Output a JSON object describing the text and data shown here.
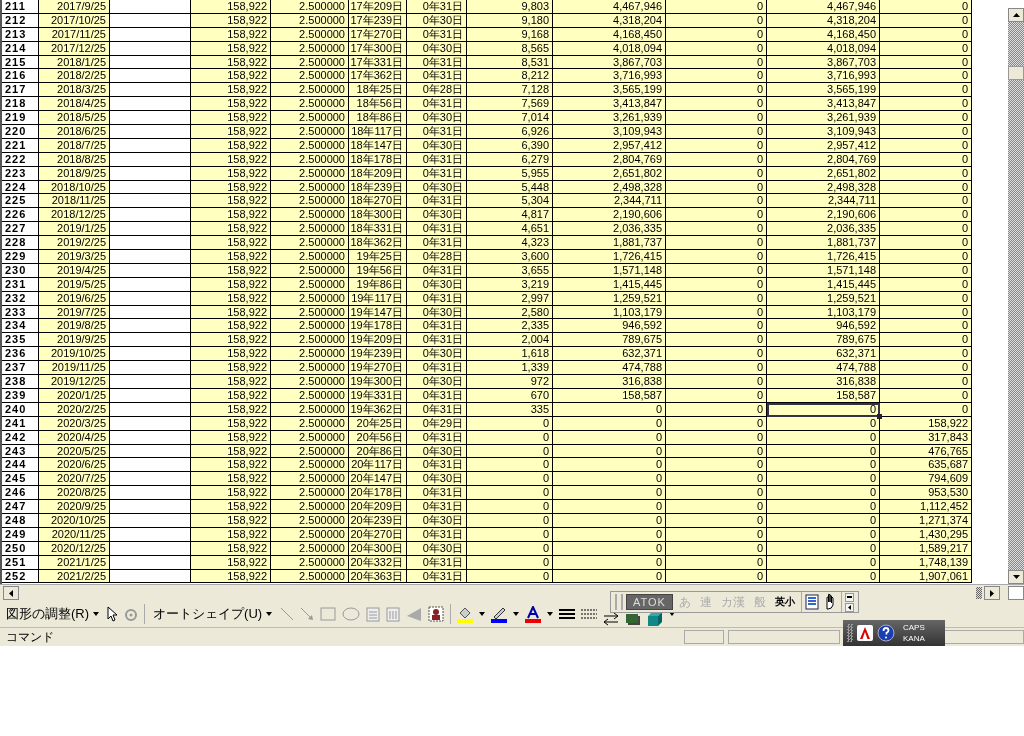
{
  "table": {
    "rows": [
      {
        "row_header": "211",
        "column_1": "2017/9/25",
        "column_3": "158,922",
        "column_4": "2.500000",
        "column_5": "17年209日",
        "column_6": "0年31日",
        "column_7": "9,803",
        "column_8": "4,467,946",
        "column_9": "0",
        "column_10": "4,467,946",
        "column_11": "0",
        "selected": false
      },
      {
        "row_header": "212",
        "column_1": "2017/10/25",
        "column_3": "158,922",
        "column_4": "2.500000",
        "column_5": "17年239日",
        "column_6": "0年30日",
        "column_7": "9,180",
        "column_8": "4,318,204",
        "column_9": "0",
        "column_10": "4,318,204",
        "column_11": "0",
        "selected": false
      },
      {
        "row_header": "213",
        "column_1": "2017/11/25",
        "column_3": "158,922",
        "column_4": "2.500000",
        "column_5": "17年270日",
        "column_6": "0年31日",
        "column_7": "9,168",
        "column_8": "4,168,450",
        "column_9": "0",
        "column_10": "4,168,450",
        "column_11": "0",
        "selected": false
      },
      {
        "row_header": "214",
        "column_1": "2017/12/25",
        "column_3": "158,922",
        "column_4": "2.500000",
        "column_5": "17年300日",
        "column_6": "0年30日",
        "column_7": "8,565",
        "column_8": "4,018,094",
        "column_9": "0",
        "column_10": "4,018,094",
        "column_11": "0",
        "selected": false
      },
      {
        "row_header": "215",
        "column_1": "2018/1/25",
        "column_3": "158,922",
        "column_4": "2.500000",
        "column_5": "17年331日",
        "column_6": "0年31日",
        "column_7": "8,531",
        "column_8": "3,867,703",
        "column_9": "0",
        "column_10": "3,867,703",
        "column_11": "0",
        "selected": false
      },
      {
        "row_header": "216",
        "column_1": "2018/2/25",
        "column_3": "158,922",
        "column_4": "2.500000",
        "column_5": "17年362日",
        "column_6": "0年31日",
        "column_7": "8,212",
        "column_8": "3,716,993",
        "column_9": "0",
        "column_10": "3,716,993",
        "column_11": "0",
        "selected": false
      },
      {
        "row_header": "217",
        "column_1": "2018/3/25",
        "column_3": "158,922",
        "column_4": "2.500000",
        "column_5": "18年25日",
        "column_6": "0年28日",
        "column_7": "7,128",
        "column_8": "3,565,199",
        "column_9": "0",
        "column_10": "3,565,199",
        "column_11": "0",
        "selected": false
      },
      {
        "row_header": "218",
        "column_1": "2018/4/25",
        "column_3": "158,922",
        "column_4": "2.500000",
        "column_5": "18年56日",
        "column_6": "0年31日",
        "column_7": "7,569",
        "column_8": "3,413,847",
        "column_9": "0",
        "column_10": "3,413,847",
        "column_11": "0",
        "selected": false
      },
      {
        "row_header": "219",
        "column_1": "2018/5/25",
        "column_3": "158,922",
        "column_4": "2.500000",
        "column_5": "18年86日",
        "column_6": "0年30日",
        "column_7": "7,014",
        "column_8": "3,261,939",
        "column_9": "0",
        "column_10": "3,261,939",
        "column_11": "0",
        "selected": false
      },
      {
        "row_header": "220",
        "column_1": "2018/6/25",
        "column_3": "158,922",
        "column_4": "2.500000",
        "column_5": "18年117日",
        "column_6": "0年31日",
        "column_7": "6,926",
        "column_8": "3,109,943",
        "column_9": "0",
        "column_10": "3,109,943",
        "column_11": "0",
        "selected": false
      },
      {
        "row_header": "221",
        "column_1": "2018/7/25",
        "column_3": "158,922",
        "column_4": "2.500000",
        "column_5": "18年147日",
        "column_6": "0年30日",
        "column_7": "6,390",
        "column_8": "2,957,412",
        "column_9": "0",
        "column_10": "2,957,412",
        "column_11": "0",
        "selected": false
      },
      {
        "row_header": "222",
        "column_1": "2018/8/25",
        "column_3": "158,922",
        "column_4": "2.500000",
        "column_5": "18年178日",
        "column_6": "0年31日",
        "column_7": "6,279",
        "column_8": "2,804,769",
        "column_9": "0",
        "column_10": "2,804,769",
        "column_11": "0",
        "selected": false
      },
      {
        "row_header": "223",
        "column_1": "2018/9/25",
        "column_3": "158,922",
        "column_4": "2.500000",
        "column_5": "18年209日",
        "column_6": "0年31日",
        "column_7": "5,955",
        "column_8": "2,651,802",
        "column_9": "0",
        "column_10": "2,651,802",
        "column_11": "0",
        "selected": false
      },
      {
        "row_header": "224",
        "column_1": "2018/10/25",
        "column_3": "158,922",
        "column_4": "2.500000",
        "column_5": "18年239日",
        "column_6": "0年30日",
        "column_7": "5,448",
        "column_8": "2,498,328",
        "column_9": "0",
        "column_10": "2,498,328",
        "column_11": "0",
        "selected": false
      },
      {
        "row_header": "225",
        "column_1": "2018/11/25",
        "column_3": "158,922",
        "column_4": "2.500000",
        "column_5": "18年270日",
        "column_6": "0年31日",
        "column_7": "5,304",
        "column_8": "2,344,711",
        "column_9": "0",
        "column_10": "2,344,711",
        "column_11": "0",
        "selected": false
      },
      {
        "row_header": "226",
        "column_1": "2018/12/25",
        "column_3": "158,922",
        "column_4": "2.500000",
        "column_5": "18年300日",
        "column_6": "0年30日",
        "column_7": "4,817",
        "column_8": "2,190,606",
        "column_9": "0",
        "column_10": "2,190,606",
        "column_11": "0",
        "selected": false
      },
      {
        "row_header": "227",
        "column_1": "2019/1/25",
        "column_3": "158,922",
        "column_4": "2.500000",
        "column_5": "18年331日",
        "column_6": "0年31日",
        "column_7": "4,651",
        "column_8": "2,036,335",
        "column_9": "0",
        "column_10": "2,036,335",
        "column_11": "0",
        "selected": false
      },
      {
        "row_header": "228",
        "column_1": "2019/2/25",
        "column_3": "158,922",
        "column_4": "2.500000",
        "column_5": "18年362日",
        "column_6": "0年31日",
        "column_7": "4,323",
        "column_8": "1,881,737",
        "column_9": "0",
        "column_10": "1,881,737",
        "column_11": "0",
        "selected": false
      },
      {
        "row_header": "229",
        "column_1": "2019/3/25",
        "column_3": "158,922",
        "column_4": "2.500000",
        "column_5": "19年25日",
        "column_6": "0年28日",
        "column_7": "3,600",
        "column_8": "1,726,415",
        "column_9": "0",
        "column_10": "1,726,415",
        "column_11": "0",
        "selected": false
      },
      {
        "row_header": "230",
        "column_1": "2019/4/25",
        "column_3": "158,922",
        "column_4": "2.500000",
        "column_5": "19年56日",
        "column_6": "0年31日",
        "column_7": "3,655",
        "column_8": "1,571,148",
        "column_9": "0",
        "column_10": "1,571,148",
        "column_11": "0",
        "selected": false
      },
      {
        "row_header": "231",
        "column_1": "2019/5/25",
        "column_3": "158,922",
        "column_4": "2.500000",
        "column_5": "19年86日",
        "column_6": "0年30日",
        "column_7": "3,219",
        "column_8": "1,415,445",
        "column_9": "0",
        "column_10": "1,415,445",
        "column_11": "0",
        "selected": false
      },
      {
        "row_header": "232",
        "column_1": "2019/6/25",
        "column_3": "158,922",
        "column_4": "2.500000",
        "column_5": "19年117日",
        "column_6": "0年31日",
        "column_7": "2,997",
        "column_8": "1,259,521",
        "column_9": "0",
        "column_10": "1,259,521",
        "column_11": "0",
        "selected": false
      },
      {
        "row_header": "233",
        "column_1": "2019/7/25",
        "column_3": "158,922",
        "column_4": "2.500000",
        "column_5": "19年147日",
        "column_6": "0年30日",
        "column_7": "2,580",
        "column_8": "1,103,179",
        "column_9": "0",
        "column_10": "1,103,179",
        "column_11": "0",
        "selected": false
      },
      {
        "row_header": "234",
        "column_1": "2019/8/25",
        "column_3": "158,922",
        "column_4": "2.500000",
        "column_5": "19年178日",
        "column_6": "0年31日",
        "column_7": "2,335",
        "column_8": "946,592",
        "column_9": "0",
        "column_10": "946,592",
        "column_11": "0",
        "selected": false
      },
      {
        "row_header": "235",
        "column_1": "2019/9/25",
        "column_3": "158,922",
        "column_4": "2.500000",
        "column_5": "19年209日",
        "column_6": "0年31日",
        "column_7": "2,004",
        "column_8": "789,675",
        "column_9": "0",
        "column_10": "789,675",
        "column_11": "0",
        "selected": false
      },
      {
        "row_header": "236",
        "column_1": "2019/10/25",
        "column_3": "158,922",
        "column_4": "2.500000",
        "column_5": "19年239日",
        "column_6": "0年30日",
        "column_7": "1,618",
        "column_8": "632,371",
        "column_9": "0",
        "column_10": "632,371",
        "column_11": "0",
        "selected": false
      },
      {
        "row_header": "237",
        "column_1": "2019/11/25",
        "column_3": "158,922",
        "column_4": "2.500000",
        "column_5": "19年270日",
        "column_6": "0年31日",
        "column_7": "1,339",
        "column_8": "474,788",
        "column_9": "0",
        "column_10": "474,788",
        "column_11": "0",
        "selected": false
      },
      {
        "row_header": "238",
        "column_1": "2019/12/25",
        "column_3": "158,922",
        "column_4": "2.500000",
        "column_5": "19年300日",
        "column_6": "0年30日",
        "column_7": "972",
        "column_8": "316,838",
        "column_9": "0",
        "column_10": "316,838",
        "column_11": "0",
        "selected": false
      },
      {
        "row_header": "239",
        "column_1": "2020/1/25",
        "column_3": "158,922",
        "column_4": "2.500000",
        "column_5": "19年331日",
        "column_6": "0年31日",
        "column_7": "670",
        "column_8": "158,587",
        "column_9": "0",
        "column_10": "158,587",
        "column_11": "0",
        "selected": false
      },
      {
        "row_header": "240",
        "column_1": "2020/2/25",
        "column_3": "158,922",
        "column_4": "2.500000",
        "column_5": "19年362日",
        "column_6": "0年31日",
        "column_7": "335",
        "column_8": "0",
        "column_9": "0",
        "column_10": "0",
        "column_11": "0",
        "selected": true
      },
      {
        "row_header": "241",
        "column_1": "2020/3/25",
        "column_3": "158,922",
        "column_4": "2.500000",
        "column_5": "20年25日",
        "column_6": "0年29日",
        "column_7": "0",
        "column_8": "0",
        "column_9": "0",
        "column_10": "0",
        "column_11": "158,922",
        "selected": false
      },
      {
        "row_header": "242",
        "column_1": "2020/4/25",
        "column_3": "158,922",
        "column_4": "2.500000",
        "column_5": "20年56日",
        "column_6": "0年31日",
        "column_7": "0",
        "column_8": "0",
        "column_9": "0",
        "column_10": "0",
        "column_11": "317,843",
        "selected": false
      },
      {
        "row_header": "243",
        "column_1": "2020/5/25",
        "column_3": "158,922",
        "column_4": "2.500000",
        "column_5": "20年86日",
        "column_6": "0年30日",
        "column_7": "0",
        "column_8": "0",
        "column_9": "0",
        "column_10": "0",
        "column_11": "476,765",
        "selected": false
      },
      {
        "row_header": "244",
        "column_1": "2020/6/25",
        "column_3": "158,922",
        "column_4": "2.500000",
        "column_5": "20年117日",
        "column_6": "0年31日",
        "column_7": "0",
        "column_8": "0",
        "column_9": "0",
        "column_10": "0",
        "column_11": "635,687",
        "selected": false
      },
      {
        "row_header": "245",
        "column_1": "2020/7/25",
        "column_3": "158,922",
        "column_4": "2.500000",
        "column_5": "20年147日",
        "column_6": "0年30日",
        "column_7": "0",
        "column_8": "0",
        "column_9": "0",
        "column_10": "0",
        "column_11": "794,609",
        "selected": false
      },
      {
        "row_header": "246",
        "column_1": "2020/8/25",
        "column_3": "158,922",
        "column_4": "2.500000",
        "column_5": "20年178日",
        "column_6": "0年31日",
        "column_7": "0",
        "column_8": "0",
        "column_9": "0",
        "column_10": "0",
        "column_11": "953,530",
        "selected": false
      },
      {
        "row_header": "247",
        "column_1": "2020/9/25",
        "column_3": "158,922",
        "column_4": "2.500000",
        "column_5": "20年209日",
        "column_6": "0年31日",
        "column_7": "0",
        "column_8": "0",
        "column_9": "0",
        "column_10": "0",
        "column_11": "1,112,452",
        "selected": false
      },
      {
        "row_header": "248",
        "column_1": "2020/10/25",
        "column_3": "158,922",
        "column_4": "2.500000",
        "column_5": "20年239日",
        "column_6": "0年30日",
        "column_7": "0",
        "column_8": "0",
        "column_9": "0",
        "column_10": "0",
        "column_11": "1,271,374",
        "selected": false
      },
      {
        "row_header": "249",
        "column_1": "2020/11/25",
        "column_3": "158,922",
        "column_4": "2.500000",
        "column_5": "20年270日",
        "column_6": "0年31日",
        "column_7": "0",
        "column_8": "0",
        "column_9": "0",
        "column_10": "0",
        "column_11": "1,430,295",
        "selected": false
      },
      {
        "row_header": "250",
        "column_1": "2020/12/25",
        "column_3": "158,922",
        "column_4": "2.500000",
        "column_5": "20年300日",
        "column_6": "0年30日",
        "column_7": "0",
        "column_8": "0",
        "column_9": "0",
        "column_10": "0",
        "column_11": "1,589,217",
        "selected": false
      },
      {
        "row_header": "251",
        "column_1": "2021/1/25",
        "column_3": "158,922",
        "column_4": "2.500000",
        "column_5": "20年332日",
        "column_6": "0年31日",
        "column_7": "0",
        "column_8": "0",
        "column_9": "0",
        "column_10": "0",
        "column_11": "1,748,139",
        "selected": false
      },
      {
        "row_header": "252",
        "column_1": "2021/2/25",
        "column_3": "158,922",
        "column_4": "2.500000",
        "column_5": "20年363日",
        "column_6": "0年31日",
        "column_7": "0",
        "column_8": "0",
        "column_9": "0",
        "column_10": "0",
        "column_11": "1,907,061",
        "selected": false
      }
    ]
  },
  "drawing_toolbar": {
    "adjust_menu": "図形の調整(R)",
    "autoshape_menu": "オートシェイプ(U)"
  },
  "ime_bar": {
    "mode_button": "ATOK",
    "buttons": [
      {
        "label": "あ",
        "disabled": true
      },
      {
        "label": "連",
        "disabled": true
      },
      {
        "label": "カ漢",
        "disabled": true
      },
      {
        "label": "般",
        "disabled": true
      },
      {
        "label": "英小",
        "disabled": false
      }
    ]
  },
  "status_bar": {
    "text": "コマンド"
  },
  "ime_status": {
    "caps": "CAPS",
    "kana": "KANA"
  }
}
